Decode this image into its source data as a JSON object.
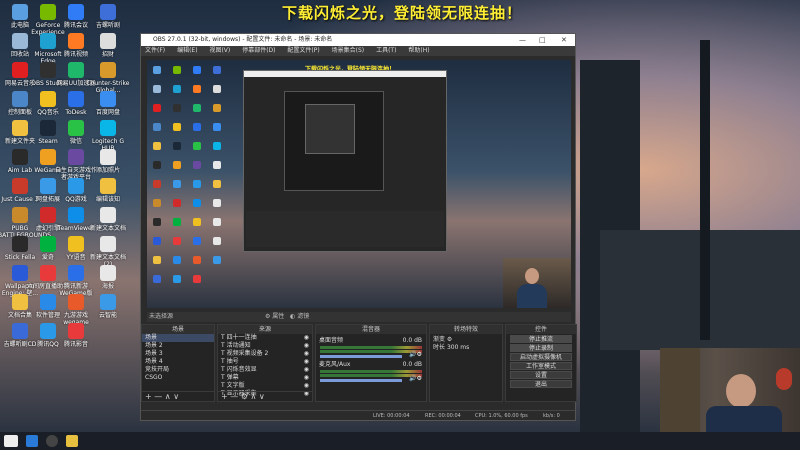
{
  "banner": "下载闪烁之光，登陆领无限连抽！",
  "desktop_icons": [
    {
      "label": "此电脑",
      "color": "#5aa0e0"
    },
    {
      "label": "GeForce Experience",
      "color": "#76b900"
    },
    {
      "label": "腾讯会议",
      "color": "#2f7cf6"
    },
    {
      "label": "吉螺听剧",
      "color": "#3e6fd8"
    },
    {
      "label": "回收站",
      "color": "#9ab8d8"
    },
    {
      "label": "Microsoft Edge",
      "color": "#1ea0d0"
    },
    {
      "label": "腾讯视频",
      "color": "#ff7a22"
    },
    {
      "label": "招财",
      "color": "#dddddd"
    },
    {
      "label": "网易云音乐",
      "color": "#e02020"
    },
    {
      "label": "OBS Studio",
      "color": "#303030"
    },
    {
      "label": "网易UU加速器",
      "color": "#1fb86a"
    },
    {
      "label": "Counter-Strike Global...",
      "color": "#d89a2a"
    },
    {
      "label": "控制面板",
      "color": "#4a86c8"
    },
    {
      "label": "QQ音乐",
      "color": "#f0c020"
    },
    {
      "label": "ToDesk",
      "color": "#2a6fe8"
    },
    {
      "label": "百度网盘",
      "color": "#3a8ef0"
    },
    {
      "label": "新建文件夹",
      "color": "#f0c040"
    },
    {
      "label": "Steam",
      "color": "#1b2838"
    },
    {
      "label": "微信",
      "color": "#2ac246"
    },
    {
      "label": "Logitech G HUB",
      "color": "#0ab5e8"
    },
    {
      "label": "Aim Lab",
      "color": "#2a2a2a"
    },
    {
      "label": "WeGame",
      "color": "#f0a020"
    },
    {
      "label": "自生自灭游戏作者游戏平台",
      "color": "#6a4aa0"
    },
    {
      "label": "添加照片",
      "color": "#e8e8e8"
    },
    {
      "label": "Just Cause 3",
      "color": "#c83a2a"
    },
    {
      "label": "网盘拓展",
      "color": "#3a9ae8"
    },
    {
      "label": "QQ游戏",
      "color": "#2a9ae8"
    },
    {
      "label": "编辑该知",
      "color": "#f0c040"
    },
    {
      "label": "PUBG BATTLEGROUNDS",
      "color": "#c88a2a"
    },
    {
      "label": "虚幻引擎",
      "color": "#d02a2a"
    },
    {
      "label": "TeamViewer",
      "color": "#0e8ee9"
    },
    {
      "label": "新建文本文档",
      "color": "#e8e8e8"
    },
    {
      "label": "Stick Fella",
      "color": "#2a2a2a"
    },
    {
      "label": "爱奇",
      "color": "#00b140"
    },
    {
      "label": "YY语音",
      "color": "#f0c020"
    },
    {
      "label": "新建文本文档 (2)",
      "color": "#e8e8e8"
    },
    {
      "label": "Wallpaper Engine: 壁...",
      "color": "#2a5ad8"
    },
    {
      "label": "六间房直播助手",
      "color": "#e83a3a"
    },
    {
      "label": "腾讯新游WeGame版",
      "color": "#2a6fe8"
    },
    {
      "label": "海报",
      "color": "#e8e8e8"
    },
    {
      "label": "文档合集",
      "color": "#f0c040"
    },
    {
      "label": "软件管理",
      "color": "#2a8ae8"
    },
    {
      "label": "九游游戏wegame",
      "color": "#e85a2a"
    },
    {
      "label": "云智能",
      "color": "#3a9ae8"
    },
    {
      "label": "吉螺听剧CD",
      "color": "#3a6ad8"
    },
    {
      "label": "腾讯QQ",
      "color": "#2a9ae8"
    },
    {
      "label": "腾讯影音",
      "color": "#e83a3a"
    }
  ],
  "obs": {
    "title": "OBS 27.0.1 (32-bit, windows) - 配置文件: 未命名 - 场景: 未命名",
    "win_controls": [
      "—",
      "□",
      "✕"
    ],
    "menu": [
      "文件(F)",
      "编辑(E)",
      "视图(V)",
      "停靠部件(D)",
      "配置文件(P)",
      "场景集合(S)",
      "工具(T)",
      "帮助(H)"
    ],
    "preview_banner": "下载闪烁之光，登陆领无限连抽！",
    "context": {
      "label": "未选择源",
      "properties": "属性",
      "filters": "滤镜"
    },
    "docks": {
      "scenes": {
        "title": "场景",
        "items": [
          "场景",
          "场景 2",
          "场景 3",
          "场景 4",
          "竞技开局",
          "CSGO"
        ],
        "selected": 0
      },
      "sources": {
        "title": "来源",
        "items": [
          "四十一连抽",
          "活动通知",
          "视频采集设备 2",
          "抽号",
          "闪烁音效显",
          "弹幕",
          "文字版",
          "显示器采集"
        ]
      },
      "mixer": {
        "title": "混音器",
        "channels": [
          {
            "name": "桌面音频",
            "value": "0.0 dB"
          },
          {
            "name": "麦克风/Aux",
            "value": "0.0 dB"
          }
        ]
      },
      "transitions": {
        "title": "转场特效",
        "type": "渐变",
        "duration_label": "时长",
        "duration": "300 ms"
      },
      "controls": {
        "title": "控件",
        "buttons": [
          "停止推流",
          "停止录制",
          "启动虚拟摄像机",
          "工作室模式",
          "设置",
          "退出"
        ]
      }
    },
    "status": {
      "live": "LIVE: 00:00:04",
      "rec": "REC: 00:00:04",
      "cpu": "CPU: 1.0%, 60.00 fps",
      "kbps": "kb/s: 0"
    }
  },
  "taskbar": {
    "items": [
      "start",
      "search",
      "task-view",
      "obs",
      "file-explorer"
    ]
  }
}
